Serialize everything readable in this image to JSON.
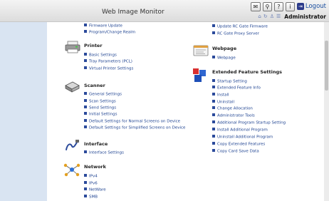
{
  "header": {
    "title": "Web Image Monitor",
    "logout_label": "Logout",
    "user_label": "Administrator",
    "toolbar_icons": [
      "mail-icon",
      "search-icon",
      "help-icon",
      "info-icon",
      "logout-icon"
    ],
    "user_icons": [
      "home-icon",
      "refresh-icon",
      "user-icon",
      "list-icon"
    ]
  },
  "left_column": {
    "top_items": [
      "Firmware Update",
      "Program/Change Realm"
    ],
    "printer": {
      "title": "Printer",
      "items": [
        "Basic Settings",
        "Tray Parameters (PCL)",
        "Virtual Printer Settings"
      ]
    },
    "scanner": {
      "title": "Scanner",
      "items": [
        "General Settings",
        "Scan Settings",
        "Send Settings",
        "Initial Settings",
        "Default Settings for Normal Screens on Device",
        "Default Settings for Simplified Screens on Device"
      ]
    },
    "interface": {
      "title": "Interface",
      "items": [
        "Interface Settings"
      ]
    },
    "network": {
      "title": "Network",
      "items": [
        "IPv4",
        "IPv6",
        "NetWare",
        "SMB"
      ]
    }
  },
  "right_column": {
    "top_items": [
      "Update RC Gate Firmware",
      "RC Gate Proxy Server"
    ],
    "webpage": {
      "title": "Webpage",
      "items": [
        "Webpage"
      ]
    },
    "extended": {
      "title": "Extended Feature Settings",
      "items": [
        "Startup Setting",
        "Extended Feature Info",
        "Install",
        "Uninstall",
        "Change Allocation",
        "Administrator Tools",
        "Additional Program Startup Setting",
        "Install Additional Program",
        "Uninstall Additional Program",
        "Copy Extended Features",
        "Copy Card Save Data"
      ]
    }
  },
  "colors": {
    "link": "#1a3f8f",
    "bullet": "#2b4a9b",
    "sidebar": "#d9e4f2",
    "header_bg": "#e6e6e6"
  }
}
